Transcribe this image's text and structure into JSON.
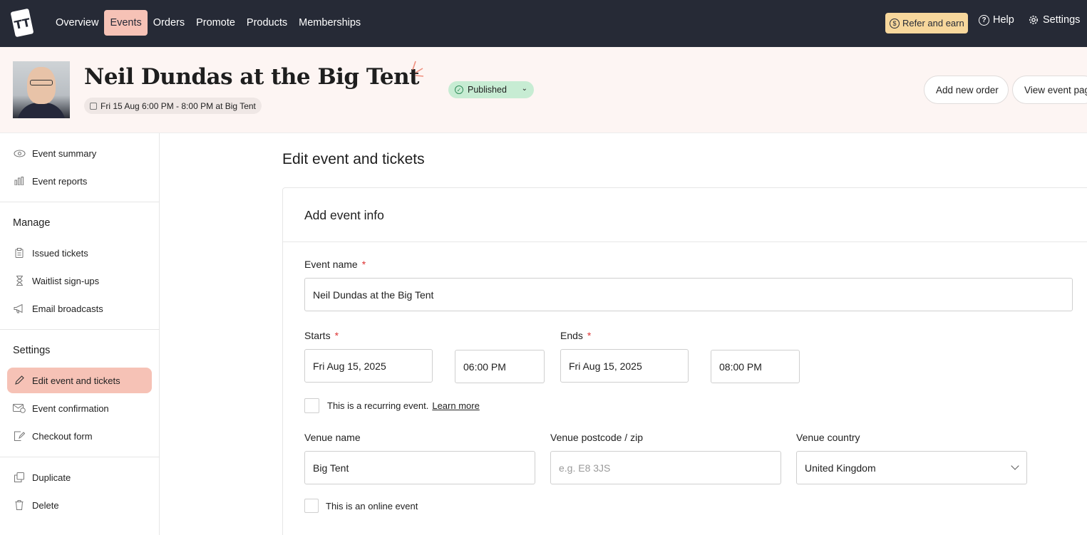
{
  "nav": {
    "items": [
      "Overview",
      "Events",
      "Orders",
      "Promote",
      "Products",
      "Memberships"
    ],
    "active": "Events",
    "refer_label": "Refer and earn",
    "help_label": "Help",
    "settings_label": "Settings"
  },
  "event": {
    "title": "Neil Dundas at the Big Tent",
    "date_line": "Fri 15 Aug 6:00 PM - 8:00 PM at Big Tent",
    "status": "Published",
    "add_order_label": "Add new order",
    "view_page_label": "View event pag"
  },
  "sidebar": {
    "top_items": [
      "Event summary",
      "Event reports"
    ],
    "manage_heading": "Manage",
    "manage_items": [
      "Issued tickets",
      "Waitlist sign-ups",
      "Email broadcasts"
    ],
    "settings_heading": "Settings",
    "settings_items": [
      "Edit event and tickets",
      "Event confirmation",
      "Checkout form"
    ],
    "bottom_items": [
      "Duplicate",
      "Delete"
    ]
  },
  "main": {
    "page_title": "Edit event and tickets",
    "card_title": "Add event info",
    "event_name_label": "Event name",
    "event_name_value": "Neil Dundas at the Big Tent",
    "starts_label": "Starts",
    "start_date": "Fri Aug 15, 2025",
    "start_time": "06:00 PM",
    "ends_label": "Ends",
    "end_date": "Fri Aug 15, 2025",
    "end_time": "08:00 PM",
    "recurring_label": "This is a recurring event.",
    "learn_more": "Learn more",
    "venue_name_label": "Venue name",
    "venue_name_value": "Big Tent",
    "venue_postcode_label": "Venue postcode / zip",
    "venue_postcode_placeholder": "e.g. E8 3JS",
    "venue_country_label": "Venue country",
    "venue_country_value": "United Kingdom",
    "online_label": "This is an online event",
    "required_mark": "*"
  },
  "colors": {
    "topbar": "#262a36",
    "accent": "#f6c2b6",
    "refer": "#f7d79c",
    "published": "#c7ecd3"
  }
}
